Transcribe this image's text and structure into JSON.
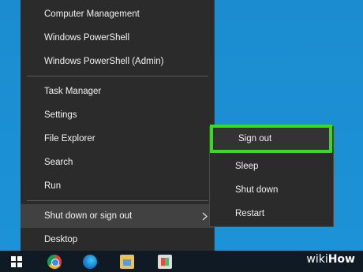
{
  "menu": {
    "items": [
      {
        "label": "Computer Management"
      },
      {
        "label": "Windows PowerShell"
      },
      {
        "label": "Windows PowerShell (Admin)"
      },
      {
        "label": "Task Manager"
      },
      {
        "label": "Settings"
      },
      {
        "label": "File Explorer"
      },
      {
        "label": "Search"
      },
      {
        "label": "Run"
      },
      {
        "label": "Shut down or sign out"
      },
      {
        "label": "Desktop"
      }
    ]
  },
  "submenu": {
    "items": [
      {
        "label": "Sign out"
      },
      {
        "label": "Sleep"
      },
      {
        "label": "Shut down"
      },
      {
        "label": "Restart"
      }
    ]
  },
  "taskbar": {
    "icons": [
      "start-icon",
      "chrome-icon",
      "edge-icon",
      "store-icon",
      "app-icon"
    ]
  },
  "watermark": {
    "part1": "wiki",
    "part2": "How"
  },
  "colors": {
    "desktop": "#1f8fd0",
    "menu_bg": "#2b2b2b",
    "hover_bg": "#414141",
    "highlight": "#32e01a",
    "taskbar": "#0f1a24"
  }
}
